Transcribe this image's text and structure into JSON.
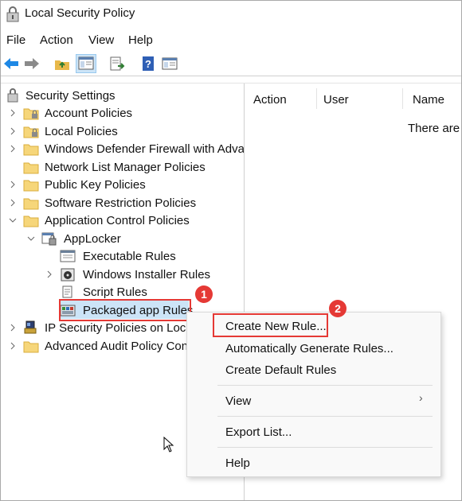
{
  "window": {
    "title": "Local Security Policy"
  },
  "menu": [
    "File",
    "Action",
    "View",
    "Help"
  ],
  "toolbar": {
    "icons": [
      "back-arrow-icon",
      "forward-arrow-icon",
      "up-folder-icon",
      "show-hide-tree-icon",
      "export-list-icon",
      "help-icon",
      "properties-icon"
    ]
  },
  "tree": {
    "root": "Security Settings",
    "account_policies": "Account Policies",
    "local_policies": "Local Policies",
    "firewall": "Windows Defender Firewall with Advanced Security",
    "network_list": "Network List Manager Policies",
    "public_key": "Public Key Policies",
    "software_restriction": "Software Restriction Policies",
    "app_control": "Application Control Policies",
    "applocker": "AppLocker",
    "executable_rules": "Executable Rules",
    "windows_installer_rules": "Windows Installer Rules",
    "script_rules": "Script Rules",
    "packaged_app_rules": "Packaged app Rules",
    "ip_security": "IP Security Policies on Local Computer",
    "advanced_audit": "Advanced Audit Policy Configuration"
  },
  "list": {
    "columns": [
      "Action",
      "User",
      "Name"
    ],
    "empty_message": "There are no items to show in this view."
  },
  "context_menu": {
    "create_new_rule": "Create New Rule...",
    "auto_generate": "Automatically Generate Rules...",
    "create_default": "Create Default Rules",
    "view": "View",
    "view_arrow": "›",
    "export_list": "Export List...",
    "help": "Help"
  },
  "annotations": {
    "step1": "1",
    "step2": "2"
  },
  "colors": {
    "selection": "#cce4f7",
    "highlight": "#e53935",
    "folder": "#f6d67a"
  }
}
